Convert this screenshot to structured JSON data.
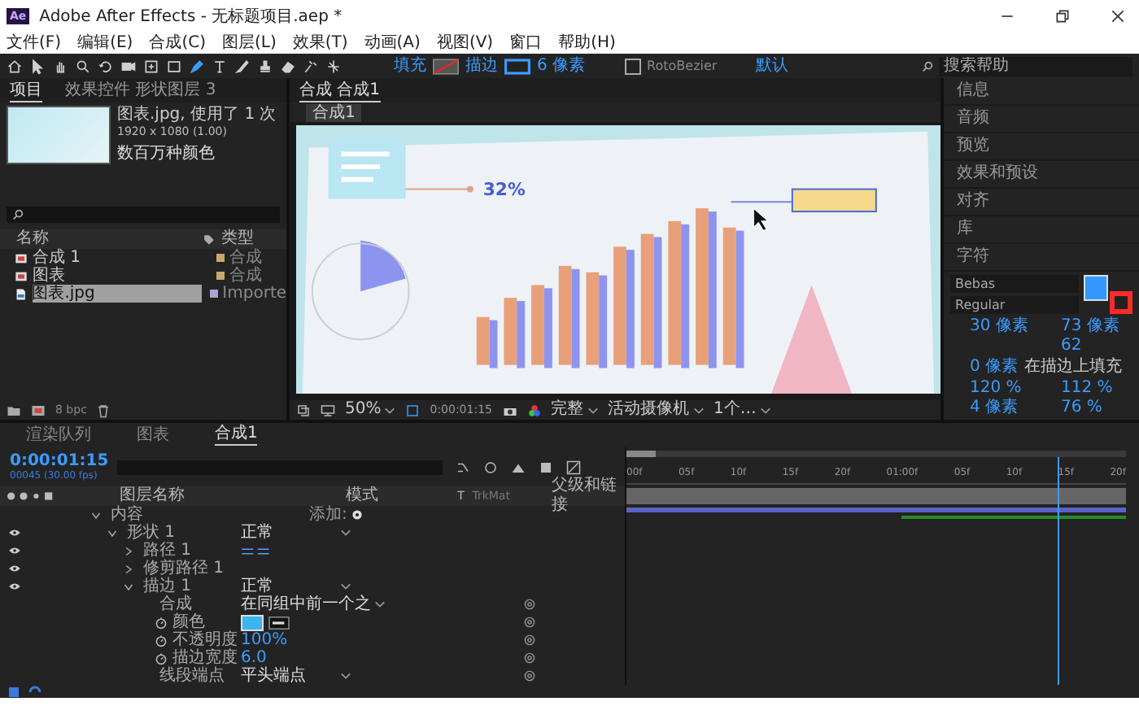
{
  "window": {
    "app_icon": "Ae",
    "title": "Adobe After Effects - 无标题项目.aep *"
  },
  "menu": [
    "文件(F)",
    "编辑(E)",
    "合成(C)",
    "图层(L)",
    "效果(T)",
    "动画(A)",
    "视图(V)",
    "窗口",
    "帮助(H)"
  ],
  "toolbar": {
    "tools": [
      {
        "selected": false
      },
      {
        "selected": false
      },
      {
        "selected": false
      },
      {
        "selected": false
      },
      {
        "selected": false
      },
      {
        "selected": false
      },
      {
        "selected": false
      },
      {
        "selected": false
      },
      {
        "selected": true
      },
      {
        "selected": false
      },
      {
        "selected": false
      },
      {
        "selected": false
      },
      {
        "selected": false
      },
      {
        "selected": false
      },
      {
        "selected": false
      }
    ],
    "fill_label": "填充",
    "stroke_label": "描边",
    "stroke_width": "6 像素",
    "roto": {
      "label": "RotoBezier",
      "checked": false
    },
    "workspace": "默认",
    "search": {
      "placeholder": "搜索帮助"
    }
  },
  "project": {
    "tabs": [
      {
        "label": "项目",
        "selected": true
      },
      {
        "label": "效果控件 形状图层 3",
        "selected": false
      }
    ],
    "asset": {
      "name": "图表.jpg",
      "usage": ", 使用了 1 次",
      "size": "1920 x 1080 (1.00)",
      "colors": "数百万种颜色"
    },
    "columns": [
      "名称",
      "类型"
    ],
    "items": [
      {
        "name": "合成 1",
        "type": "合成",
        "kind": "comp",
        "color": "#c8a86e",
        "selected": false
      },
      {
        "name": "图表",
        "type": "合成",
        "kind": "comp",
        "color": "#c8a86e",
        "selected": false
      },
      {
        "name": "图表.jpg",
        "type": "Importe",
        "kind": "footage",
        "color": "#a9a4d8",
        "selected": true
      }
    ],
    "bpc": "8 bpc"
  },
  "viewer": {
    "tab": "合成 合成1",
    "breadcrumb": "合成1",
    "callout": "32%",
    "zoom": "50%",
    "time": "0:00:01:15",
    "resolution": "完整",
    "camera": "活动摄像机",
    "views": "1个…"
  },
  "panels": [
    "信息",
    "音频",
    "预览",
    "效果和预设",
    "对齐",
    "库",
    "字符"
  ],
  "character": {
    "font": "Bebas",
    "style": "Regular",
    "size": "30 像素",
    "leading": "73 像素",
    "tracking": "62",
    "stroke_width": "0 像素",
    "stroke_mode": "在描边上填充",
    "vscale": "120 %",
    "hscale": "112 %",
    "baseline": "4 像素",
    "tsume": "76 %"
  },
  "timeline": {
    "tabs": [
      {
        "label": "渲染队列",
        "selected": false
      },
      {
        "label": "图表",
        "selected": false
      },
      {
        "label": "合成1",
        "selected": true
      }
    ],
    "time": "0:00:01:15",
    "frames": "00045 (30.00 fps)",
    "columns": [
      "图层名称",
      "模式",
      "T",
      "TrkMat",
      "父级和链接"
    ],
    "ruler": [
      "00f",
      "05f",
      "10f",
      "15f",
      "20f",
      "01:00f",
      "05f",
      "10f",
      "15f",
      "20f"
    ],
    "playhead": {
      "level": 0.84
    },
    "layers": [
      {
        "name": "内容",
        "expanded": true,
        "add_label": "添加:",
        "children": [
          {
            "name": "形状 1",
            "expanded": true,
            "visible": true,
            "value": {
              "kind": "dropdown",
              "text": "正常"
            },
            "children": [
              {
                "name": "路径 1",
                "expanded": false,
                "visible": true,
                "value": {
                  "kind": "path"
                }
              },
              {
                "name": "修剪路径 1",
                "expanded": false,
                "visible": true
              },
              {
                "name": "描边 1",
                "expanded": true,
                "visible": true,
                "value": {
                  "kind": "dropdown",
                  "text": "正常"
                },
                "children": [
                  {
                    "name": "合成",
                    "pickwhip": true,
                    "value": {
                      "kind": "dropdown",
                      "text": "在同组中前一个之"
                    }
                  },
                  {
                    "name": "颜色",
                    "stopwatch": true,
                    "pickwhip": true,
                    "value": {
                      "kind": "color",
                      "color": "#3cb4f0"
                    }
                  },
                  {
                    "name": "不透明度",
                    "stopwatch": true,
                    "pickwhip": true,
                    "value": {
                      "kind": "number",
                      "text": "100%"
                    }
                  },
                  {
                    "name": "描边宽度",
                    "stopwatch": true,
                    "pickwhip": true,
                    "value": {
                      "kind": "number",
                      "text": "6.0"
                    }
                  },
                  {
                    "name": "线段端点",
                    "pickwhip": true,
                    "value": {
                      "kind": "dropdown",
                      "text": "平头端点"
                    }
                  }
                ]
              }
            ]
          }
        ]
      }
    ]
  }
}
